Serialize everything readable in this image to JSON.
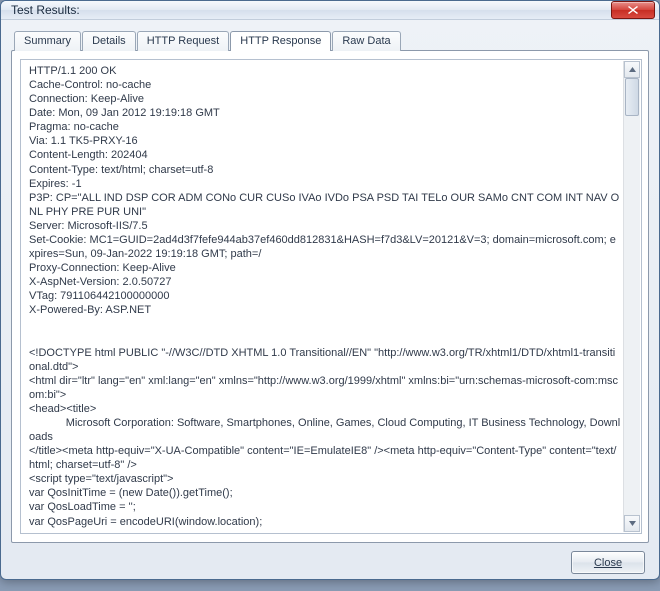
{
  "window": {
    "title": "Test Results:"
  },
  "tabs": [
    {
      "label": "Summary"
    },
    {
      "label": "Details"
    },
    {
      "label": "HTTP Request"
    },
    {
      "label": "HTTP Response"
    },
    {
      "label": "Raw Data"
    }
  ],
  "active_tab_index": 3,
  "response_text": "HTTP/1.1 200 OK\nCache-Control: no-cache\nConnection: Keep-Alive\nDate: Mon, 09 Jan 2012 19:19:18 GMT\nPragma: no-cache\nVia: 1.1 TK5-PRXY-16\nContent-Length: 202404\nContent-Type: text/html; charset=utf-8\nExpires: -1\nP3P: CP=\"ALL IND DSP COR ADM CONo CUR CUSo IVAo IVDo PSA PSD TAI TELo OUR SAMo CNT COM INT NAV ONL PHY PRE PUR UNI\"\nServer: Microsoft-IIS/7.5\nSet-Cookie: MC1=GUID=2ad4d3f7fefe944ab37ef460dd812831&HASH=f7d3&LV=20121&V=3; domain=microsoft.com; expires=Sun, 09-Jan-2022 19:19:18 GMT; path=/\nProxy-Connection: Keep-Alive\nX-AspNet-Version: 2.0.50727\nVTag: 791106442100000000\nX-Powered-By: ASP.NET\n\n\n<!DOCTYPE html PUBLIC \"-//W3C//DTD XHTML 1.0 Transitional//EN\" \"http://www.w3.org/TR/xhtml1/DTD/xhtml1-transitional.dtd\">\n<html dir=\"ltr\" lang=\"en\" xml:lang=\"en\" xmlns=\"http://www.w3.org/1999/xhtml\" xmlns:bi=\"urn:schemas-microsoft-com:mscom:bi\">\n<head><title>\n            Microsoft Corporation: Software, Smartphones, Online, Games, Cloud Computing, IT Business Technology, Downloads\n</title><meta http-equiv=\"X-UA-Compatible\" content=\"IE=EmulateIE8\" /><meta http-equiv=\"Content-Type\" content=\"text/html; charset=utf-8\" />\n<script type=\"text/javascript\">\nvar QosInitTime = (new Date()).getTime();\nvar QosLoadTime = '';\nvar QosPageUri = encodeURI(window.location);",
  "footer": {
    "close_label": "Close"
  }
}
